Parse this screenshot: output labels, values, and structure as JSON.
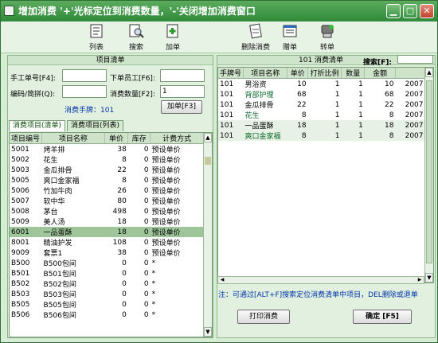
{
  "window": {
    "title": "增加消费  '+'光标定位到消费数量，'-'关闭增加消费窗口",
    "minimize": "▁",
    "restore": "▢",
    "close": "✕"
  },
  "toolbar": {
    "list": "列表",
    "search": "搜索",
    "add": "加单",
    "delete": "删除消费",
    "gift": "赠单",
    "transfer": "转单"
  },
  "left": {
    "header": "项目清单",
    "ticket_label": "手工单号[F4]:",
    "ticket_value": "",
    "staff_label": "下单员工[F6]:",
    "staff_value": "",
    "code_label": "编码/简拼(Q):",
    "code_value": "",
    "qty_label": "消费数量[F2]:",
    "qty_value": "1",
    "hand_label": "消费手牌：101",
    "add_button": "加单[F3]",
    "tabs": [
      "消费项目(清单)",
      "消费项目(列表)"
    ],
    "columns": [
      "项目编号",
      "项目名称",
      "单价",
      "库存",
      "计费方式"
    ],
    "rows": [
      [
        "5001",
        "烤羊排",
        "38",
        "0",
        "预设单价"
      ],
      [
        "5002",
        "花生",
        "8",
        "0",
        "预设单价"
      ],
      [
        "5003",
        "金瓜排骨",
        "22",
        "0",
        "预设单价"
      ],
      [
        "5005",
        "爽口金家福",
        "8",
        "0",
        "预设单价"
      ],
      [
        "5006",
        "竹加牛肉",
        "26",
        "0",
        "预设单价"
      ],
      [
        "5007",
        "软中华",
        "80",
        "0",
        "预设单价"
      ],
      [
        "5008",
        "茅台",
        "498",
        "0",
        "预设单价"
      ],
      [
        "5009",
        "美人汤",
        "18",
        "0",
        "预设单价"
      ],
      [
        "6001",
        "一品蛋酥",
        "18",
        "0",
        "预设单价"
      ],
      [
        "8001",
        "精油护发",
        "108",
        "0",
        "预设单价"
      ],
      [
        "9009",
        "套票1",
        "38",
        "0",
        "预设单价"
      ],
      [
        "B500",
        "B500包间",
        "0",
        "0",
        "*"
      ],
      [
        "B501",
        "B501包间",
        "0",
        "0",
        "*"
      ],
      [
        "B502",
        "B502包间",
        "0",
        "0",
        "*"
      ],
      [
        "B503",
        "B503包间",
        "0",
        "0",
        "*"
      ],
      [
        "B505",
        "B505包间",
        "0",
        "0",
        "*"
      ],
      [
        "B506",
        "B506包间",
        "0",
        "0",
        "*"
      ]
    ]
  },
  "right": {
    "header": "101 消费清单",
    "search_label": "搜索[F]:",
    "search_value": "",
    "columns": [
      "手牌号",
      "项目名称",
      "单价",
      "打折比例",
      "数量",
      "金额",
      ""
    ],
    "rows": [
      [
        "101",
        "男浴资",
        "10",
        "1",
        "1",
        "10",
        "2007"
      ],
      [
        "101",
        "背部护理",
        "68",
        "1",
        "1",
        "68",
        "2007"
      ],
      [
        "101",
        "金瓜排骨",
        "22",
        "1",
        "1",
        "22",
        "2007"
      ],
      [
        "101",
        "花生",
        "8",
        "1",
        "1",
        "8",
        "2007"
      ],
      [
        "101",
        "一品蛋酥",
        "18",
        "1",
        "1",
        "18",
        "2007"
      ],
      [
        "101",
        "爽口金家福",
        "8",
        "1",
        "1",
        "8",
        "2007"
      ]
    ],
    "note": "注：可通过[ALT+F]搜索定位消费清单中项目，DEL删除或退单",
    "print_button": "打印消费",
    "ok_button": "确定 [F5]"
  }
}
